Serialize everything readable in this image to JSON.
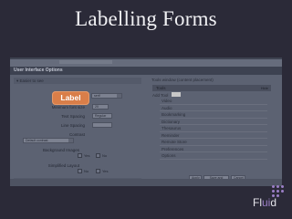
{
  "slide": {
    "title": "Labelling Forms"
  },
  "panel": {
    "header": "User Interface Options",
    "top_link": "",
    "collapse_top": "Easier to see",
    "collapse_bottom": "Easier to find"
  },
  "callout": {
    "label": "Label"
  },
  "left_fields": [
    {
      "label": "",
      "value": "serif"
    },
    {
      "label": "Minimum font size",
      "value": "20"
    },
    {
      "label": "Text Spacing",
      "value": "Regular"
    },
    {
      "label": "Line Spacing",
      "value": ""
    },
    {
      "label": "Contrast",
      "value": "Default contrast"
    },
    {
      "label": "Background Images",
      "value": ""
    },
    {
      "label": "Simplified Layout",
      "value": ""
    }
  ],
  "toggles": {
    "bg_yes": "Yes",
    "bg_no": "No",
    "simp_no": "No",
    "simp_yes": "Yes"
  },
  "right": {
    "title": "Tools window (content placement)",
    "tools_bar": "Tools",
    "tools_right": "Hide",
    "add_tool": "Add Tool",
    "items": [
      "Video",
      "Audio",
      "Bookmarking",
      "Dictionary",
      "Thesaurus",
      "Reminder",
      "Remote Store",
      "Preferences",
      "Options"
    ]
  },
  "buttons": {
    "apply": "Apply",
    "save_apply": "Save and apply",
    "cancel": "Cancel"
  },
  "logo": {
    "part1": "Fl",
    "part2": "ui",
    "part3": "d"
  }
}
